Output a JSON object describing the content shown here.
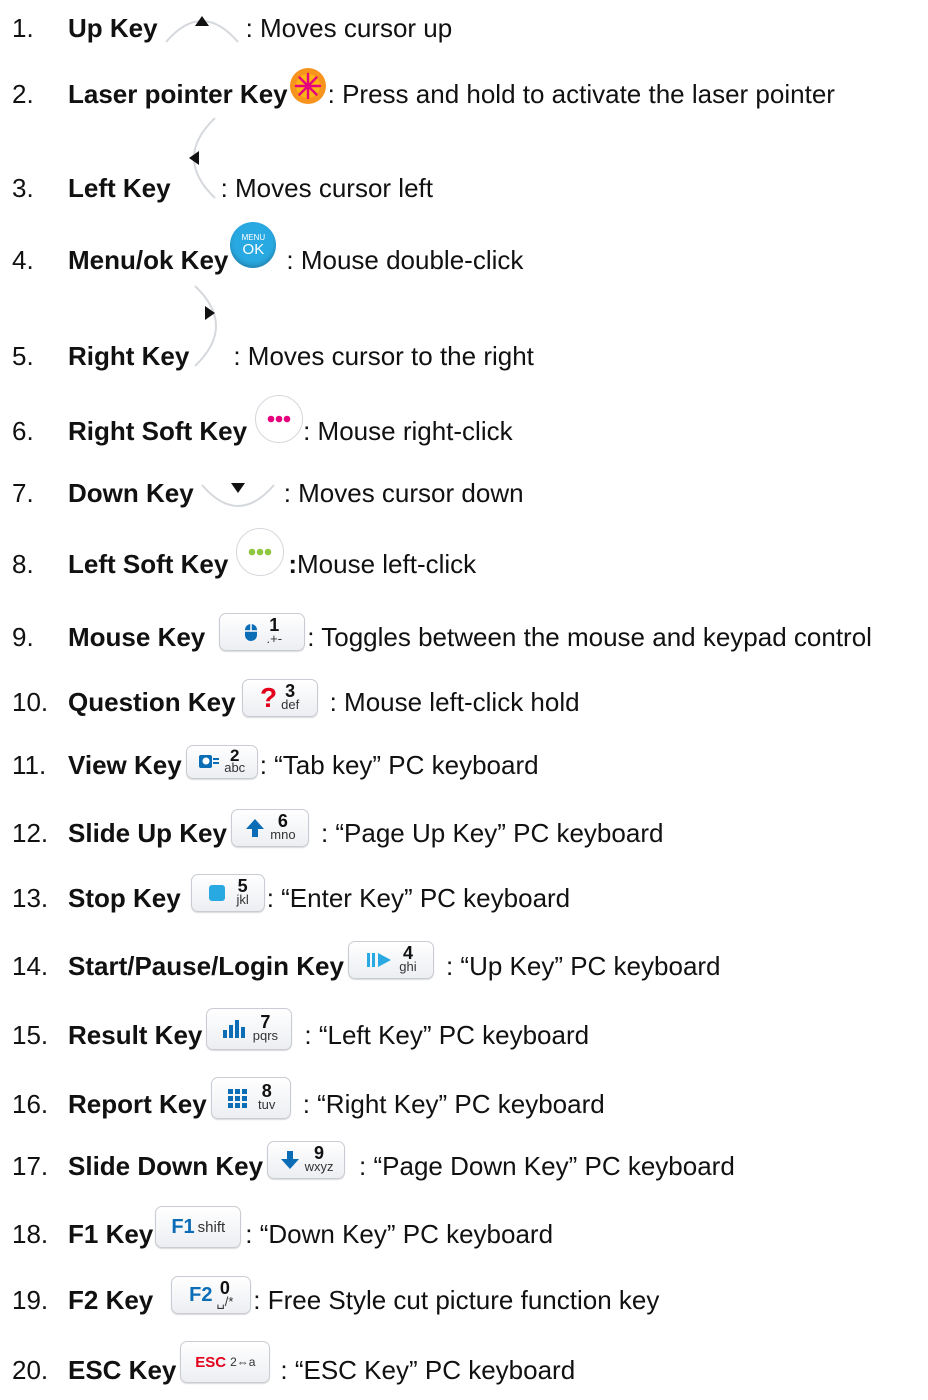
{
  "items": [
    {
      "num": "1.",
      "name": "Up Key",
      "icon": "arrow-up-icon",
      "desc": ": Moves cursor up"
    },
    {
      "num": "2.",
      "name": "Laser pointer Key",
      "icon": "laser-starburst-icon",
      "desc": " : Press and hold to activate the laser pointer"
    },
    {
      "num": "3.",
      "name": "Left Key",
      "icon": "arrow-left-icon",
      "desc": ": Moves cursor left"
    },
    {
      "num": "4.",
      "name": "Menu/ok Key",
      "icon": "menu-ok-icon",
      "desc": ": Mouse double-click",
      "icon_text_top": "MENU",
      "icon_text_bottom": "OK"
    },
    {
      "num": "5.",
      "name": "Right Key",
      "icon": "arrow-right-icon",
      "desc": ": Moves cursor to the right"
    },
    {
      "num": "6.",
      "name": "Right Soft Key",
      "icon": "right-soft-dots-icon",
      "desc": ":  Mouse right-click"
    },
    {
      "num": "7.",
      "name": "Down Key",
      "icon": "arrow-down-icon",
      "desc": ": Moves cursor down"
    },
    {
      "num": "8.",
      "name": "Left Soft Key",
      "icon": "left-soft-dots-icon",
      "desc_bold": ":",
      "desc": " Mouse left-click"
    },
    {
      "num": "9.",
      "name": "Mouse Key",
      "icon": "mouse-key-icon",
      "desc": ": Toggles between the mouse and keypad control",
      "key_digit": "1",
      "key_letters": ".+-"
    },
    {
      "num": "10.",
      "name": "Question Key",
      "icon": "question-key-icon",
      "desc": ": Mouse left-click hold",
      "key_digit": "3",
      "key_letters": "def"
    },
    {
      "num": "11.",
      "name": "View Key",
      "icon": "view-key-icon",
      "desc": ": “Tab key” PC keyboard",
      "key_digit": "2",
      "key_letters": "abc"
    },
    {
      "num": "12.",
      "name": "Slide Up Key",
      "icon": "slide-up-key-icon",
      "desc": ": “Page Up Key” PC keyboard",
      "key_digit": "6",
      "key_letters": "mno"
    },
    {
      "num": "13.",
      "name": "Stop Key",
      "icon": "stop-key-icon",
      "desc": ": “Enter Key” PC keyboard",
      "key_digit": "5",
      "key_letters": "jkl"
    },
    {
      "num": "14.",
      "name": "Start/Pause/Login Key",
      "icon": "start-pause-key-icon",
      "desc": ": “Up Key” PC keyboard",
      "key_digit": "4",
      "key_letters": "ghi"
    },
    {
      "num": "15.",
      "name": "Result Key",
      "icon": "result-key-icon",
      "desc": ": “Left Key” PC keyboard",
      "key_digit": "7",
      "key_letters": "pqrs"
    },
    {
      "num": "16.",
      "name": "Report Key",
      "icon": "report-key-icon",
      "desc": ": “Right Key” PC keyboard",
      "key_digit": "8",
      "key_letters": "tuv"
    },
    {
      "num": "17.",
      "name": "Slide Down Key",
      "icon": "slide-down-key-icon",
      "desc": ": “Page Down Key” PC keyboard",
      "key_digit": "9",
      "key_letters": "wxyz"
    },
    {
      "num": "18.",
      "name": "F1 Key",
      "icon": "f1-key-icon",
      "desc": ": “Down Key” PC keyboard",
      "key_label": "F1",
      "key_letters": "shift"
    },
    {
      "num": "19.",
      "name": "F2 Key",
      "icon": "f2-key-icon",
      "desc": ": Free Style cut picture function key",
      "key_label": "F2",
      "key_digit": "0",
      "key_letters": "␣/*"
    },
    {
      "num": "20.",
      "name": "ESC Key",
      "icon": "esc-key-icon",
      "desc": ": “ESC Key” PC keyboard",
      "key_label": "ESC",
      "key_letters": "2⇔a"
    }
  ],
  "colors": {
    "laser_orange": "#f7941d",
    "laser_magenta": "#e6007e",
    "menu_blue": "#29a9e1",
    "right_soft_dots": "#e6007e",
    "left_soft_dots": "#8dc63f",
    "key_icon_blue": "#0b6db5",
    "question_red": "#e3001b",
    "esc_red": "#e3001b"
  }
}
